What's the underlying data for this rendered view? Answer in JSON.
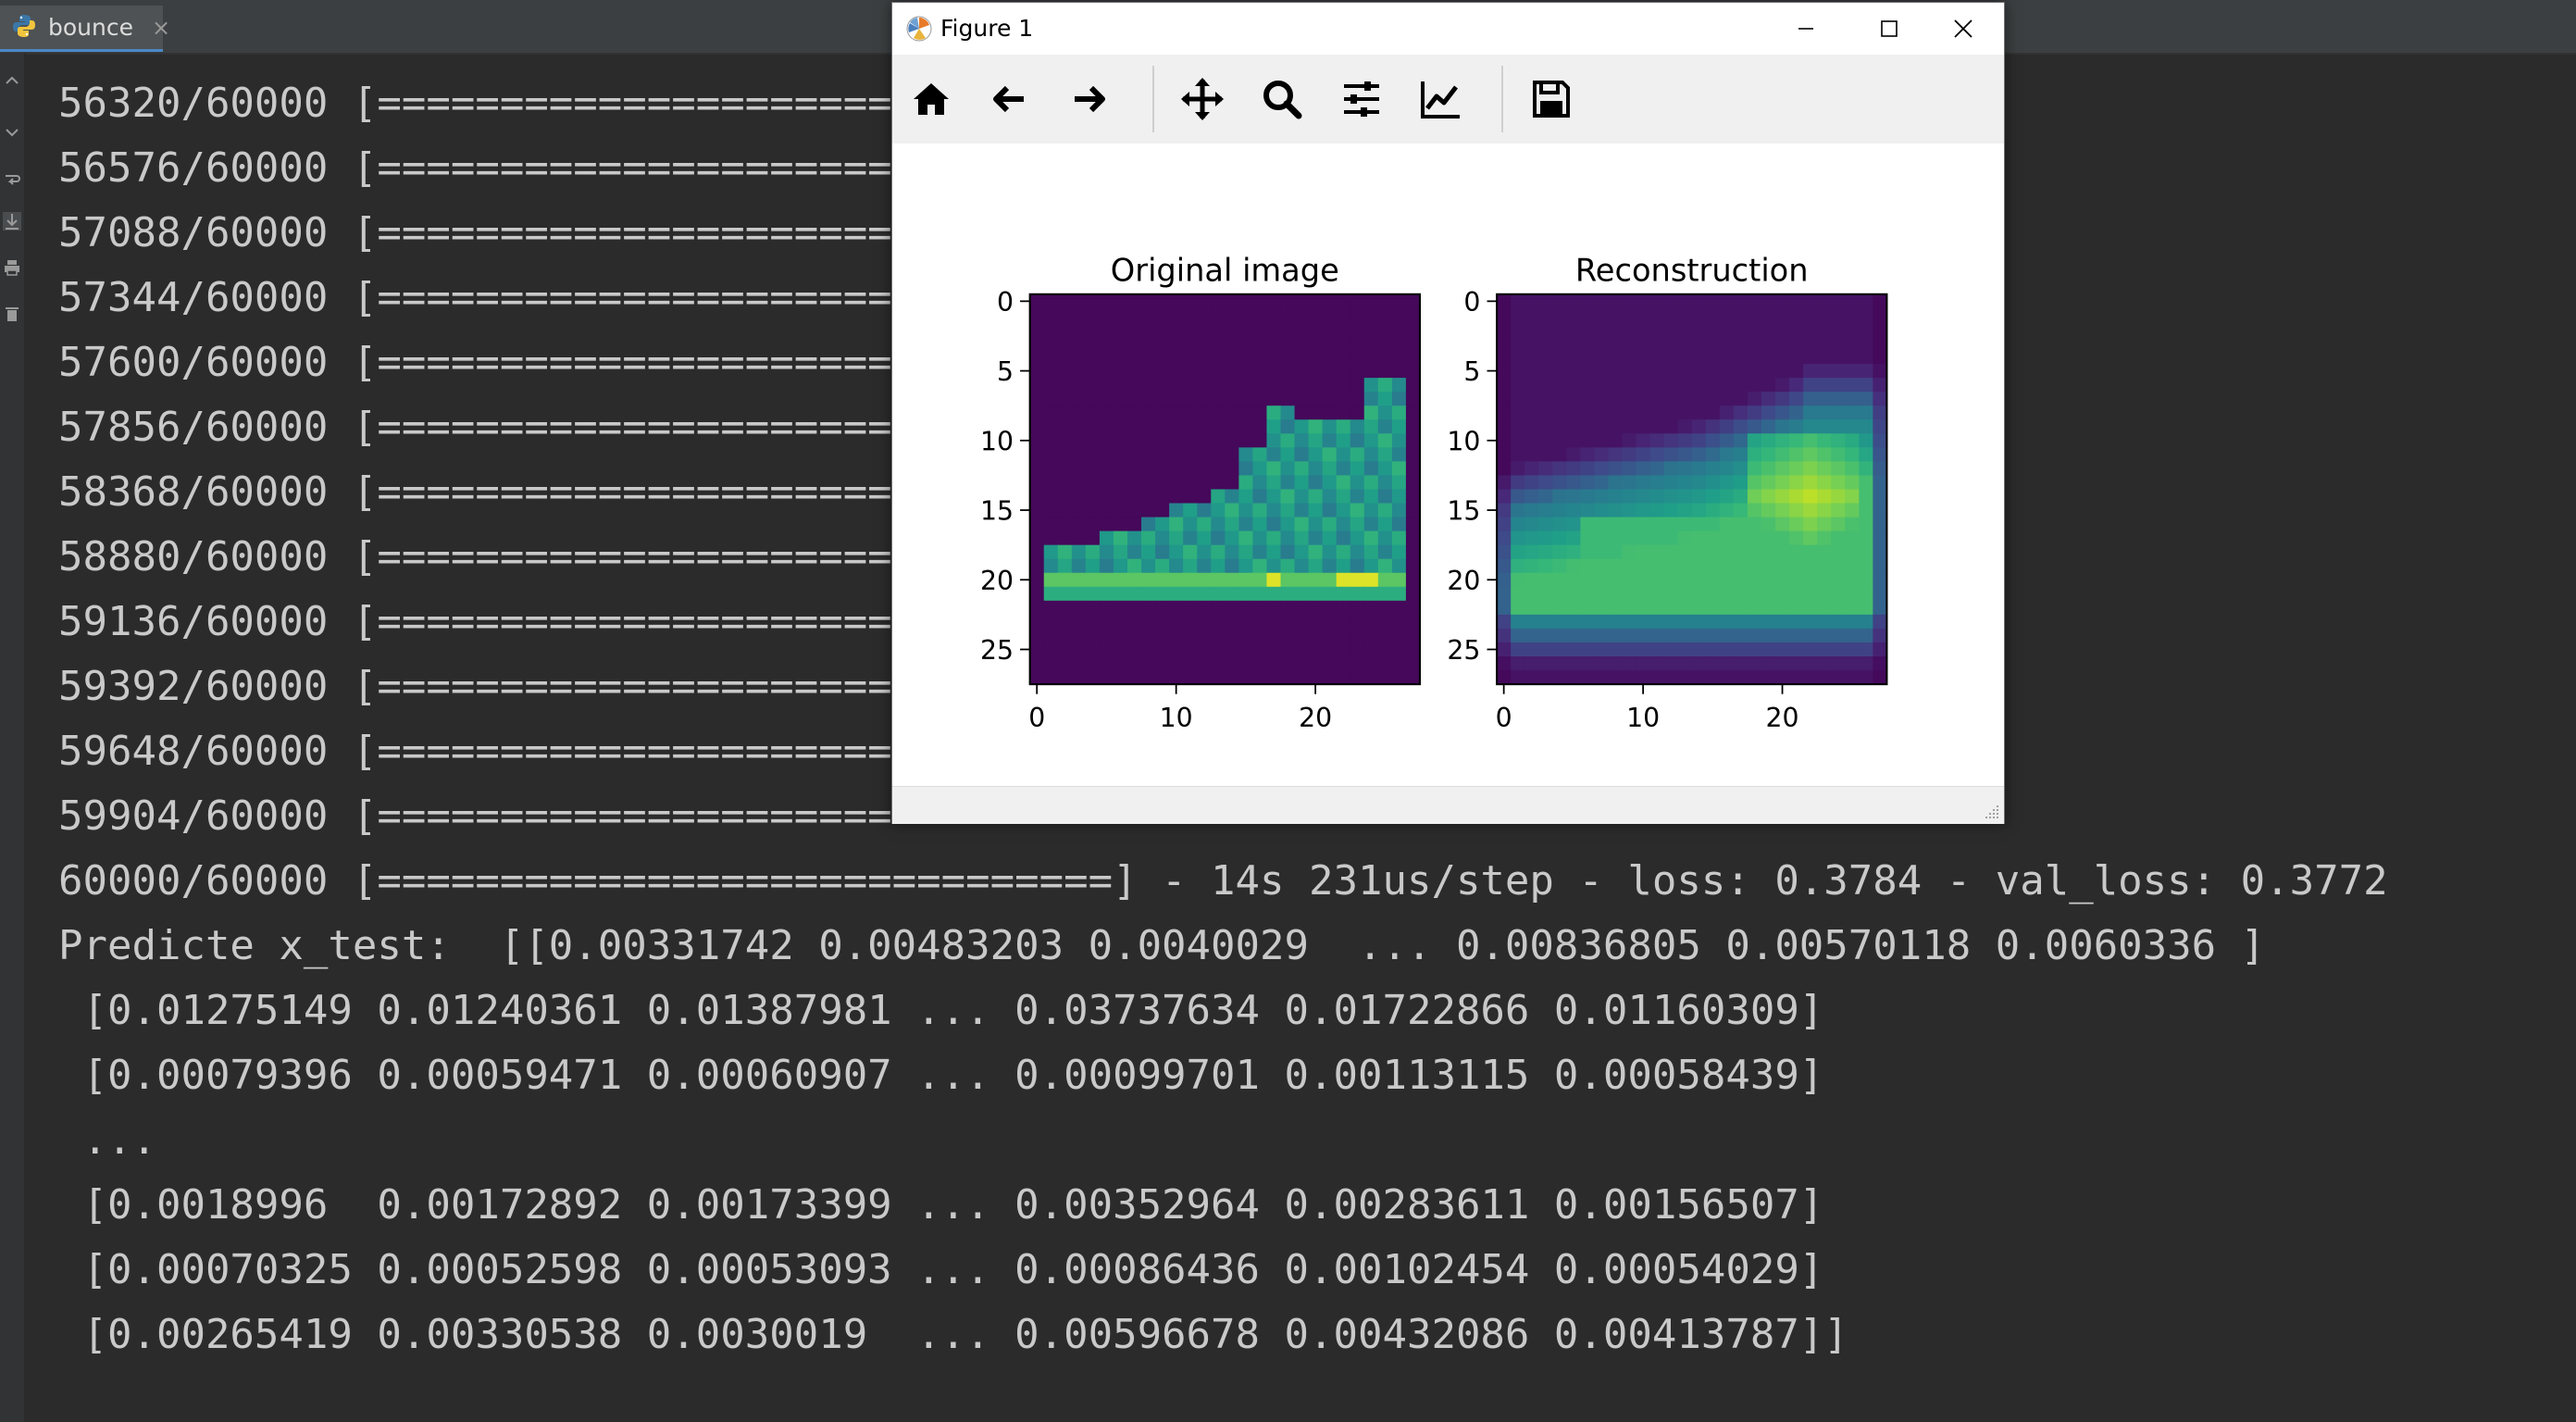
{
  "run_tab": {
    "label": "bounce",
    "close_glyph": "×",
    "icon": "python-icon"
  },
  "console": {
    "progress_lines": [
      "56320/60000 [=======================",
      "56576/60000 [=======================",
      "57088/60000 [=======================",
      "57344/60000 [=======================",
      "57600/60000 [=======================",
      "57856/60000 [=======================",
      "58368/60000 [=======================",
      "58880/60000 [=======================",
      "59136/60000 [=======================",
      "59392/60000 [=======================",
      "59648/60000 [=======================",
      "59904/60000 [======================="
    ],
    "final_line": "60000/60000 [==============================] - 14s 231us/step - loss: 0.3784 - val_loss: 0.3772",
    "output_lines": [
      "Predicte x_test:  [[0.00331742 0.00483203 0.0040029  ... 0.00836805 0.00570118 0.0060336 ]",
      " [0.01275149 0.01240361 0.01387981 ... 0.03737634 0.01722866 0.01160309]",
      " [0.00079396 0.00059471 0.00060907 ... 0.00099701 0.00113115 0.00058439]",
      " ...",
      " [0.0018996  0.00172892 0.00173399 ... 0.00352964 0.00283611 0.00156507]",
      " [0.00070325 0.00052598 0.00053093 ... 0.00086436 0.00102454 0.00054029]",
      " [0.00265419 0.00330538 0.0030019  ... 0.00596678 0.00432086 0.00413787]]"
    ]
  },
  "figure_window": {
    "title": "Figure 1",
    "controls": {
      "minimize": "minimize-icon",
      "maximize": "maximize-icon",
      "close": "close-icon"
    },
    "toolbar": [
      "home-icon",
      "back-arrow-icon",
      "forward-arrow-icon",
      "pan-icon",
      "zoom-icon",
      "subplots-config-icon",
      "axes-edit-icon",
      "save-icon"
    ]
  },
  "chart_data": [
    {
      "type": "heatmap",
      "title": "Original image",
      "grid_size": [
        28,
        28
      ],
      "x_ticks": [
        0,
        10,
        20
      ],
      "y_ticks": [
        0,
        5,
        10,
        15,
        20,
        25
      ],
      "xlim": [
        -0.5,
        27.5
      ],
      "ylim": [
        27.5,
        -0.5
      ],
      "colormap": "viridis",
      "vmin": 0,
      "vmax": 1
    },
    {
      "type": "heatmap",
      "title": "Reconstruction",
      "grid_size": [
        28,
        28
      ],
      "x_ticks": [
        0,
        10,
        20
      ],
      "y_ticks": [
        0,
        5,
        10,
        15,
        20,
        25
      ],
      "xlim": [
        -0.5,
        27.5
      ],
      "ylim": [
        27.5,
        -0.5
      ],
      "colormap": "viridis",
      "vmin": 0,
      "vmax": 1
    }
  ],
  "colors": {
    "console_bg": "#2b2b2b",
    "console_text": "#c9c9c9",
    "viridis": [
      "#440154",
      "#482878",
      "#3e4989",
      "#31688e",
      "#26828e",
      "#1f9e89",
      "#35b779",
      "#6ece58",
      "#b5de2b",
      "#fde725"
    ]
  }
}
